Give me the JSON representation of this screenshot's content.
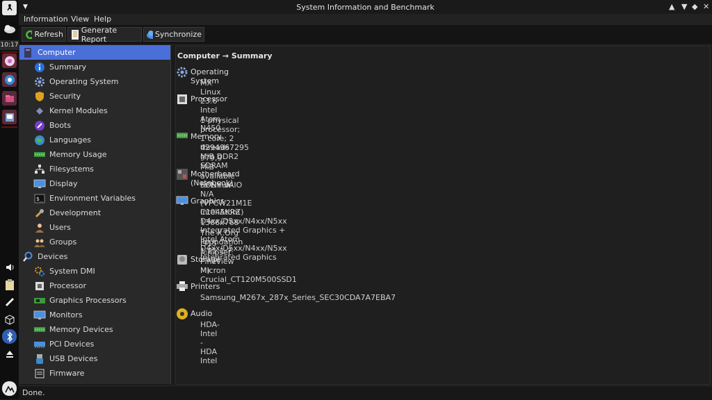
{
  "window": {
    "title": "System Information and Benchmark"
  },
  "dock": {
    "clock": "10:17"
  },
  "menu": {
    "items": [
      "Information",
      "View",
      "Help"
    ]
  },
  "toolbar": {
    "refresh": "Refresh",
    "report": "Generate Report",
    "sync": "Synchronize"
  },
  "sidebar": {
    "computer": "Computer",
    "computer_items": [
      "Summary",
      "Operating System",
      "Security",
      "Kernel Modules",
      "Boots",
      "Languages",
      "Memory Usage",
      "Filesystems",
      "Display",
      "Environment Variables",
      "Development",
      "Users",
      "Groups"
    ],
    "devices": "Devices",
    "devices_items": [
      "System DMI",
      "Processor",
      "Graphics Processors",
      "Monitors",
      "Memory Devices",
      "PCI Devices",
      "USB Devices",
      "Firmware"
    ]
  },
  "main": {
    "header": "Computer → Summary",
    "sections": [
      {
        "title": "Operating System",
        "values": [
          "MX Linux 23.6"
        ]
      },
      {
        "title": "Processor",
        "values": [
          "Intel Atom N450",
          "1 physical processor; 1 core; 2 threads"
        ]
      },
      {
        "title": "Memory",
        "values": [
          "4294967295 MiB DDR2 SDRAM",
          "979,9 MiB available to Linux"
        ]
      },
      {
        "title": "Motherboard (Notebook)",
        "values": [
          "SONY VAIO N/A (VPCW21M1E C1045KRZ)"
        ]
      },
      {
        "title": "Graphics",
        "values": [
          "Intel Atom D4xx/D5xx/N4xx/N5xx Integrated Graphics + Intel Atom D4xx/D5xx/N4xx/N5xx Integrated Graphics",
          "1366x768",
          "The X.Org Foundation 1.21.1.7",
          "i915 (chipset: Pineview M)"
        ]
      },
      {
        "title": "Storage",
        "values": [
          "Micron Crucial_CT120M500SSD1"
        ]
      },
      {
        "title": "Printers",
        "values": [
          "Samsung_M267x_287x_Series_SEC30CDA7A7EBA7"
        ]
      },
      {
        "title": "Audio",
        "values": [
          "HDA-Intel - HDA Intel"
        ]
      }
    ]
  },
  "status": {
    "text": "Done."
  }
}
